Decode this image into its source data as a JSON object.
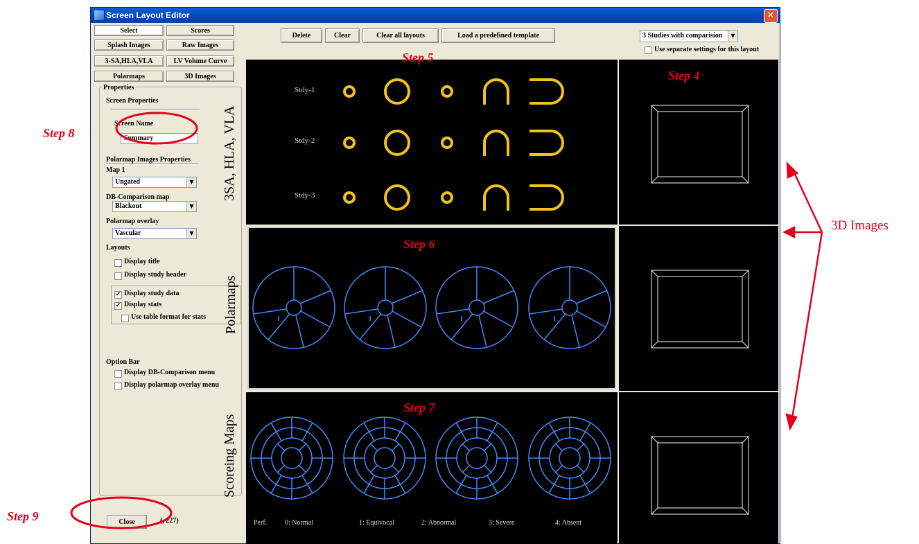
{
  "window": {
    "title": "Screen Layout Editor",
    "close_glyph": "✕"
  },
  "nav_buttons": [
    "Select",
    "Scores",
    "Splash Images",
    "Raw Images",
    "3-SA,HLA,VLA",
    "LV Volume Curve",
    "Polarmaps",
    "3D Images"
  ],
  "toolbar": {
    "delete": "Delete",
    "clear": "Clear",
    "clear_all": "Clear all layouts",
    "load_template": "Load a predefined template"
  },
  "layout_select": {
    "value": "3 Studies with comparision",
    "separate_settings": "Use separate settings for this layout"
  },
  "properties": {
    "title": "Properties",
    "screen_props": "Screen Properties",
    "screen_name_label": "Screen Name",
    "screen_name_value": "Summary",
    "polarmap_props": "Polarmap Images Properties",
    "map1_label": "Map 1",
    "map1_value": "Ungated",
    "db_label": "DB-Comparison map",
    "db_value": "Blackout",
    "overlay_label": "Polarmap overlay",
    "overlay_value": "Vascular",
    "layouts_label": "Layouts",
    "display_title": "Display title",
    "display_study_header": "Display study header",
    "display_study_data": "Display study data",
    "display_stats": "Display stats",
    "table_format": "Use table format for stats",
    "option_bar": "Option Bar",
    "display_db_menu": "Display DB-Comparison menu",
    "display_overlay_menu": "Display polarmap overlay menu"
  },
  "checks": {
    "display_title": false,
    "display_study_header": false,
    "display_study_data": true,
    "display_stats": true,
    "table_format": false,
    "db_menu": false,
    "overlay_menu": false,
    "separate": false,
    "check_glyph": "✔"
  },
  "footer": {
    "close": "Close",
    "coords": "(, 227)"
  },
  "studies": [
    "Stdy-1",
    "Stdy-2",
    "Stdy-3"
  ],
  "legend": [
    "Perf.",
    "0: Normal",
    "1: Equivocal",
    "2: Abnormal",
    "3: Severe",
    "4: Absent"
  ],
  "annotations": {
    "step4": "Step 4",
    "step5": "Step 5",
    "step6": "Step 6",
    "step7": "Step 7",
    "step8": "Step 8",
    "step9": "Step 9",
    "row1": "3SA, HLA, VLA",
    "row2": "Polarmaps",
    "row3": "Scoreing Maps",
    "images3d": "3D Images"
  },
  "colors": {
    "accent": "#e3001b",
    "shape": "#f2c21a",
    "map": "#3f8cff",
    "panel": "#000000"
  }
}
